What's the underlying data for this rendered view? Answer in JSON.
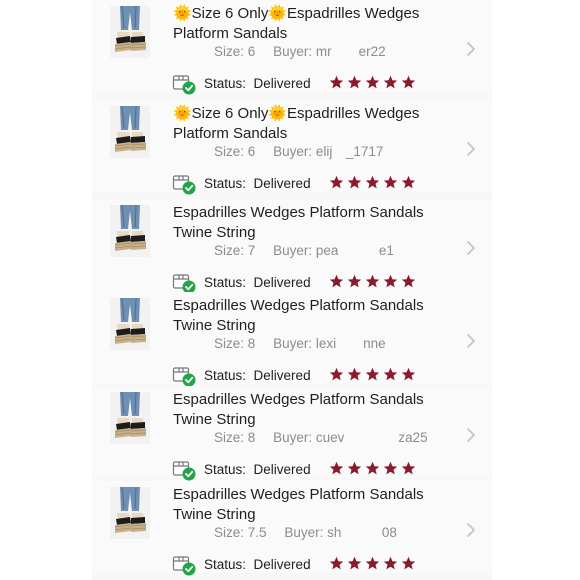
{
  "colors": {
    "star": "#8b1a2b",
    "check": "#22a447",
    "chevron": "#c4c4c4",
    "meta": "#8c8c8c"
  },
  "orders": [
    {
      "title_prefix_icon": "sun-emoji-icon",
      "title": "🌞Size 6 Only🌞Espadrilles Wedges Platform Sandals",
      "size_label": "Size:",
      "size": "6",
      "buyer_label": "Buyer:",
      "buyer": "mr  er22",
      "status_label": "Status:",
      "status": "Delivered",
      "rating": 5
    },
    {
      "title_prefix_icon": "sun-emoji-icon",
      "title": "🌞Size 6 Only🌞Espadrilles Wedges Platform Sandals",
      "size_label": "Size:",
      "size": "6",
      "buyer_label": "Buyer:",
      "buyer": "elij _1717",
      "status_label": "Status:",
      "status": "Delivered",
      "rating": 5
    },
    {
      "title": "Espadrilles Wedges Platform Sandals Twine String",
      "size_label": "Size:",
      "size": "7",
      "buyer_label": "Buyer:",
      "buyer": "pea   e1",
      "status_label": "Status:",
      "status": "Delivered",
      "rating": 5
    },
    {
      "title": "Espadrilles Wedges Platform Sandals Twine String",
      "size_label": "Size:",
      "size": "8",
      "buyer_label": "Buyer:",
      "buyer": "lexi  nne",
      "status_label": "Status:",
      "status": "Delivered",
      "rating": 5
    },
    {
      "title": "Espadrilles Wedges Platform Sandals Twine String",
      "size_label": "Size:",
      "size": "8",
      "buyer_label": "Buyer:",
      "buyer": "cuev    za25",
      "status_label": "Status:",
      "status": "Delivered",
      "rating": 5
    },
    {
      "title": "Espadrilles Wedges Platform Sandals Twine String",
      "size_label": "Size:",
      "size": "7.5",
      "buyer_label": "Buyer:",
      "buyer": "sh   08",
      "status_label": "Status:",
      "status": "Delivered",
      "rating": 5
    }
  ]
}
